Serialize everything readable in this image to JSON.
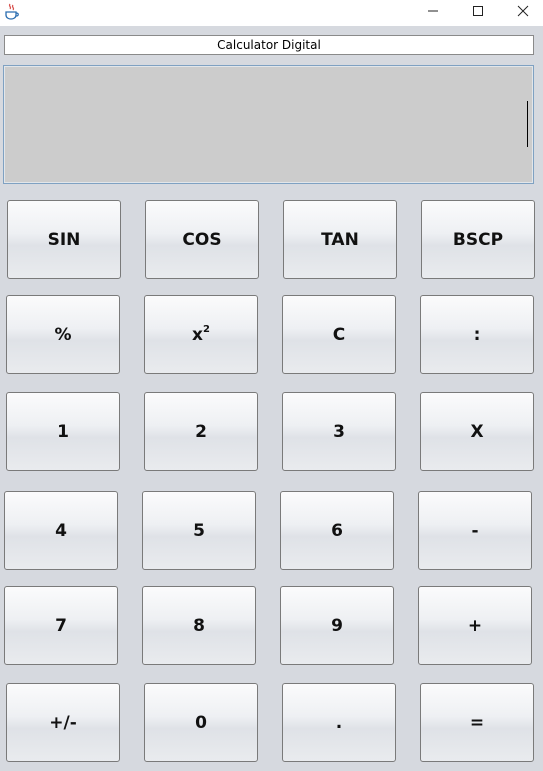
{
  "title_field": {
    "value": "Calculator Digital"
  },
  "display": {
    "value": ""
  },
  "icons": {
    "app": "java-coffee-icon",
    "minimize": "minimize-icon",
    "maximize": "maximize-icon",
    "close": "close-icon"
  },
  "colors": {
    "background": "#d6d9df",
    "display_bg": "#cccccc",
    "display_border": "#7fa1c2",
    "button_border": "#7a7a7a"
  },
  "buttons": {
    "sin": "SIN",
    "cos": "COS",
    "tan": "TAN",
    "bscp": "BSCP",
    "percent": "%",
    "square_base": "x",
    "square_exp": "2",
    "clear": "C",
    "divide": ":",
    "one": "1",
    "two": "2",
    "three": "3",
    "multiply": "X",
    "four": "4",
    "five": "5",
    "six": "6",
    "minus": "-",
    "seven": "7",
    "eight": "8",
    "nine": "9",
    "plus": "+",
    "negate": "+/-",
    "zero": "0",
    "dot": ".",
    "equals": "="
  }
}
